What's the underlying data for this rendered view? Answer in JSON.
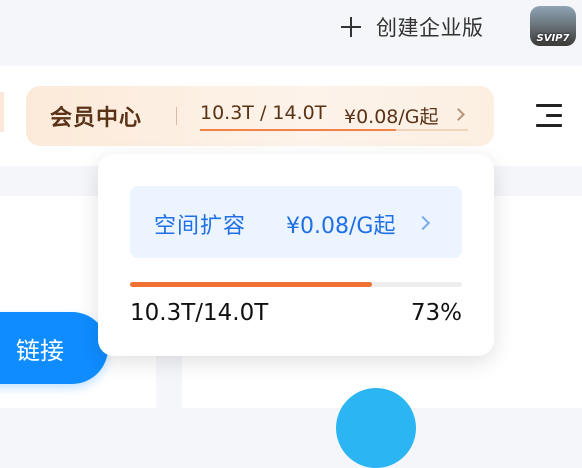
{
  "header": {
    "create_label": "创建企业版",
    "avatar_badge": "SVIP7"
  },
  "member": {
    "title": "会员中心",
    "usage": "10.3T / 14.0T",
    "price": "¥0.08/G起",
    "usage_fraction": 0.73,
    "accent": "#f1834a"
  },
  "popover": {
    "expand_title": "空间扩容",
    "expand_price": "¥0.08/G起",
    "usage": "10.3T/14.0T",
    "percent": "73%",
    "usage_fraction": 0.73,
    "bar_color": "#f07334",
    "link_color": "#1f6fe5"
  },
  "content": {
    "link_button_label": "链接"
  },
  "icons": {
    "create": "plus-icon",
    "menu": "hamburger-menu-icon",
    "chevron": "chevron-right-icon"
  }
}
